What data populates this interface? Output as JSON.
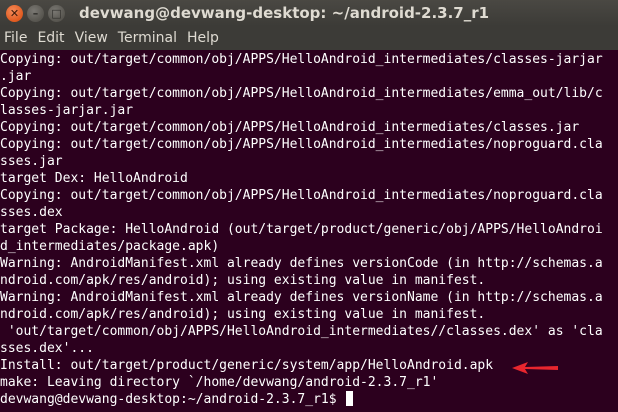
{
  "window": {
    "title": "devwang@devwang-desktop: ~/android-2.3.7_r1",
    "buttons": {
      "close": "✕",
      "minimize": "–",
      "maximize": "□"
    }
  },
  "menu": [
    "File",
    "Edit",
    "View",
    "Terminal",
    "Help"
  ],
  "terminal": {
    "lines": [
      "Copying: out/target/common/obj/APPS/HelloAndroid_intermediates/classes-jarjar",
      ".jar",
      "Copying: out/target/common/obj/APPS/HelloAndroid_intermediates/emma_out/lib/c",
      "lasses-jarjar.jar",
      "Copying: out/target/common/obj/APPS/HelloAndroid_intermediates/classes.jar",
      "Copying: out/target/common/obj/APPS/HelloAndroid_intermediates/noproguard.cla",
      "sses.jar",
      "target Dex: HelloAndroid",
      "Copying: out/target/common/obj/APPS/HelloAndroid_intermediates/noproguard.cla",
      "sses.dex",
      "target Package: HelloAndroid (out/target/product/generic/obj/APPS/HelloAndroi",
      "d_intermediates/package.apk)",
      "Warning: AndroidManifest.xml already defines versionCode (in http://schemas.a",
      "ndroid.com/apk/res/android); using existing value in manifest.",
      "Warning: AndroidManifest.xml already defines versionName (in http://schemas.a",
      "ndroid.com/apk/res/android); using existing value in manifest.",
      " 'out/target/common/obj/APPS/HelloAndroid_intermediates//classes.dex' as 'cla",
      "sses.dex'...",
      "Install: out/target/product/generic/system/app/HelloAndroid.apk",
      "make: Leaving directory `/home/devwang/android-2.3.7_r1'"
    ],
    "prompt": "devwang@devwang-desktop:~/android-2.3.7_r1$ "
  },
  "colors": {
    "terminal_bg": "#2c001e",
    "terminal_fg": "#ffffff",
    "titlebar_bg": "#3c3b37",
    "close_button": "#e05a1f",
    "annotation_arrow": "#e8262e"
  }
}
